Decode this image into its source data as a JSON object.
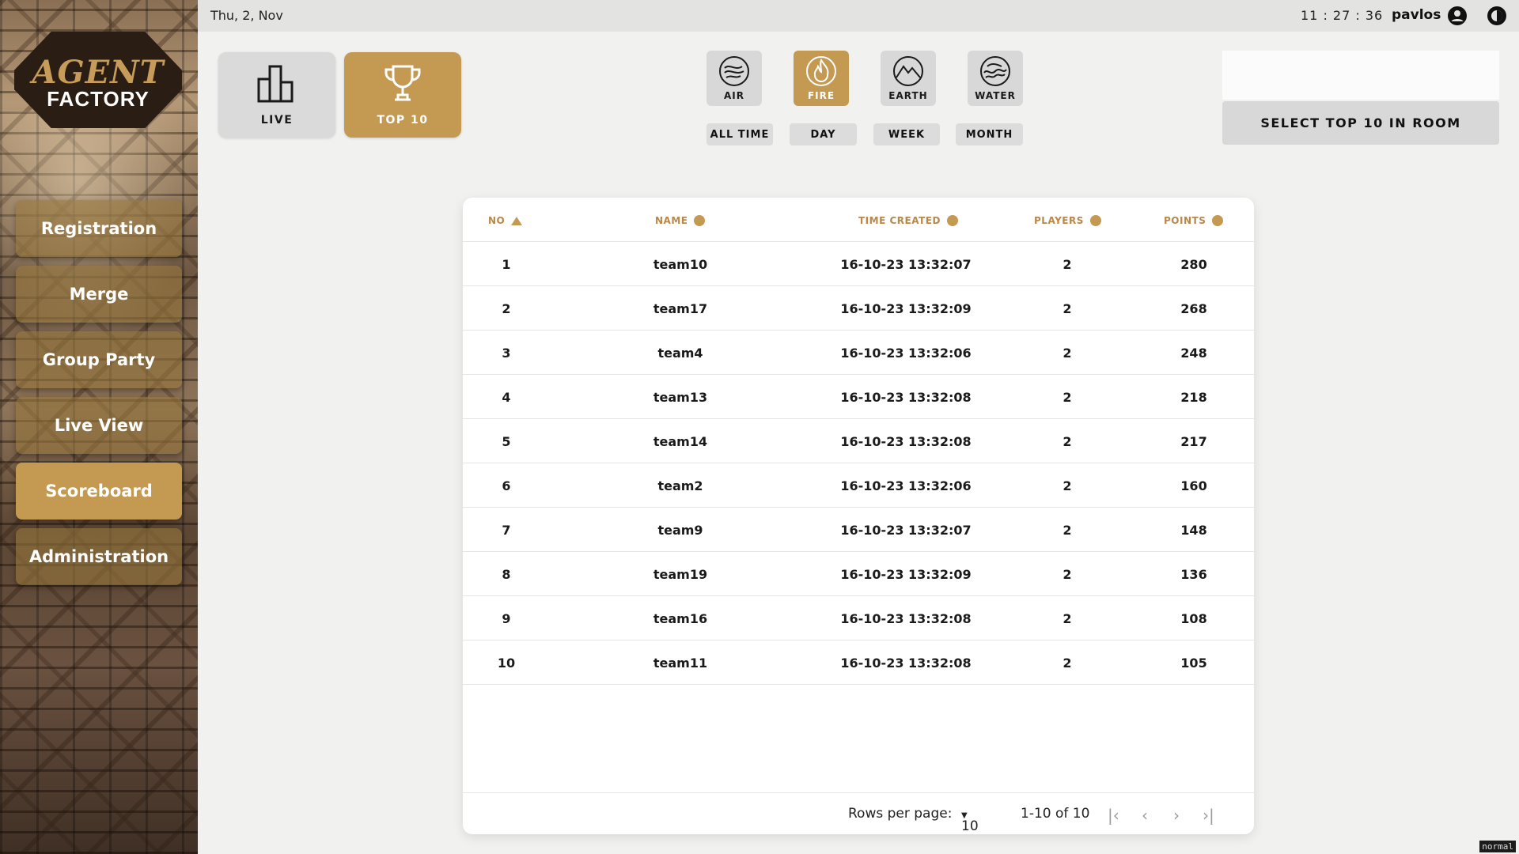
{
  "sidebar": {
    "logo_top": "AGENT",
    "logo_bottom": "FACTORY",
    "items": [
      {
        "label": "Registration"
      },
      {
        "label": "Merge"
      },
      {
        "label": "Group Party"
      },
      {
        "label": "Live View"
      },
      {
        "label": "Scoreboard",
        "active": true
      },
      {
        "label": "Administration"
      }
    ]
  },
  "header": {
    "date": "Thu, 2, Nov",
    "time": "11 : 27 : 36",
    "user": "pavlos",
    "icons": [
      "user-account-icon",
      "theme-toggle-icon"
    ]
  },
  "modes": {
    "live": "LIVE",
    "top10": "TOP 10",
    "active": "top10"
  },
  "elements": [
    {
      "label": "AIR",
      "icon": "air-element-icon"
    },
    {
      "label": "FIRE",
      "icon": "fire-element-icon",
      "active": true
    },
    {
      "label": "EARTH",
      "icon": "earth-element-icon"
    },
    {
      "label": "WATER",
      "icon": "water-element-icon"
    }
  ],
  "periods": [
    "ALL TIME",
    "DAY",
    "WEEK",
    "MONTH"
  ],
  "select_button": "SELECT TOP 10 IN ROOM",
  "table": {
    "columns": [
      "NO",
      "NAME",
      "TIME CREATED",
      "PLAYERS",
      "POINTS"
    ],
    "rows": [
      [
        "1",
        "team10",
        "16-10-23 13:32:07",
        "2",
        "280"
      ],
      [
        "2",
        "team17",
        "16-10-23 13:32:09",
        "2",
        "268"
      ],
      [
        "3",
        "team4",
        "16-10-23 13:32:06",
        "2",
        "248"
      ],
      [
        "4",
        "team13",
        "16-10-23 13:32:08",
        "2",
        "218"
      ],
      [
        "5",
        "team14",
        "16-10-23 13:32:08",
        "2",
        "217"
      ],
      [
        "6",
        "team2",
        "16-10-23 13:32:06",
        "2",
        "160"
      ],
      [
        "7",
        "team9",
        "16-10-23 13:32:07",
        "2",
        "148"
      ],
      [
        "8",
        "team19",
        "16-10-23 13:32:09",
        "2",
        "136"
      ],
      [
        "9",
        "team16",
        "16-10-23 13:32:08",
        "2",
        "108"
      ],
      [
        "10",
        "team11",
        "16-10-23 13:32:08",
        "2",
        "105"
      ]
    ]
  },
  "pagination": {
    "rows_per_page_label": "Rows per page:",
    "rows_per_page": "10",
    "range": "1-10 of 10"
  },
  "status_badge": "normal",
  "colors": {
    "accent": "#c49a52",
    "header_text": "#b8874a"
  }
}
